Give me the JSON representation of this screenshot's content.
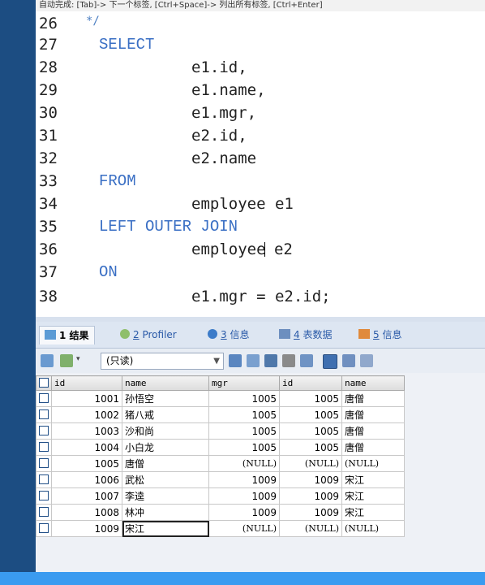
{
  "hint_text": "自动完成: [Tab]-> 下一个标签, [Ctrl+Space]-> 列出所有标签, [Ctrl+Enter]",
  "code_lines": [
    {
      "num": "26",
      "text": "*/"
    },
    {
      "num": "27",
      "text": "SELECT"
    },
    {
      "num": "28",
      "text": "e1.id,"
    },
    {
      "num": "29",
      "text": "e1.name,"
    },
    {
      "num": "30",
      "text": "e1.mgr,"
    },
    {
      "num": "31",
      "text": "e2.id,"
    },
    {
      "num": "32",
      "text": "e2.name"
    },
    {
      "num": "33",
      "text": "FROM"
    },
    {
      "num": "34",
      "text": "employee e1"
    },
    {
      "num": "35",
      "text": "LEFT OUTER JOIN"
    },
    {
      "num": "36",
      "text_before_caret": "employee",
      "text_after_caret": " e2"
    },
    {
      "num": "37",
      "text": "ON"
    },
    {
      "num": "38",
      "text": "e1.mgr = e2.id;"
    }
  ],
  "tabs": [
    {
      "num": "1",
      "label": "结果"
    },
    {
      "num": "2",
      "label": "Profiler"
    },
    {
      "num": "3",
      "label": "信息"
    },
    {
      "num": "4",
      "label": "表数据"
    },
    {
      "num": "5",
      "label": "信息"
    }
  ],
  "toolbar": {
    "readonly_label": "(只读)"
  },
  "columns": [
    "id",
    "name",
    "mgr",
    "id",
    "name"
  ],
  "rows": [
    [
      "1001",
      "孙悟空",
      "1005",
      "1005",
      "唐僧"
    ],
    [
      "1002",
      "猪八戒",
      "1005",
      "1005",
      "唐僧"
    ],
    [
      "1003",
      "沙和尚",
      "1005",
      "1005",
      "唐僧"
    ],
    [
      "1004",
      "小白龙",
      "1005",
      "1005",
      "唐僧"
    ],
    [
      "1005",
      "唐僧",
      "(NULL)",
      "(NULL)",
      "(NULL)"
    ],
    [
      "1006",
      "武松",
      "1009",
      "1009",
      "宋江"
    ],
    [
      "1007",
      "李逵",
      "1009",
      "1009",
      "宋江"
    ],
    [
      "1008",
      "林冲",
      "1009",
      "1009",
      "宋江"
    ],
    [
      "1009",
      "宋江",
      "(NULL)",
      "(NULL)",
      "(NULL)"
    ]
  ],
  "colors": {
    "keyword": "#3a6fc4",
    "frame": "#1c4d82",
    "status": "#3a9bf0"
  }
}
